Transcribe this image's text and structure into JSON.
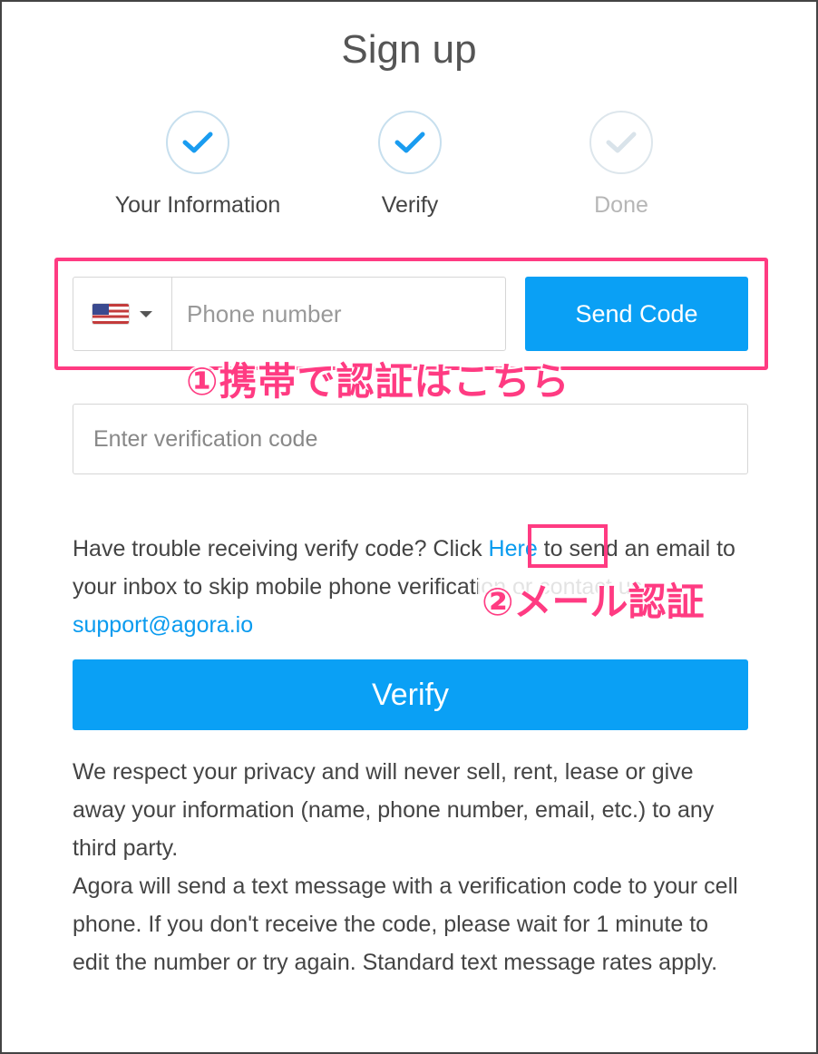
{
  "page": {
    "title": "Sign up"
  },
  "steps": [
    {
      "label": "Your Information",
      "state": "complete",
      "icon": "check-icon"
    },
    {
      "label": "Verify",
      "state": "complete",
      "icon": "check-icon"
    },
    {
      "label": "Done",
      "state": "pending",
      "icon": "check-icon"
    }
  ],
  "phone": {
    "country_icon": "us-flag-icon",
    "placeholder": "Phone number",
    "send_label": "Send Code"
  },
  "code": {
    "placeholder": "Enter verification code"
  },
  "trouble": {
    "text_before": "Have trouble receiving verify code? Click ",
    "here_label": "Here",
    "text_after": " to send an email to your inbox to skip mobile phone verification or contact us ",
    "support_email": "support@agora.io"
  },
  "verify_button": {
    "label": "Verify"
  },
  "privacy": {
    "paragraph1": "We respect your privacy and will never sell, rent, lease or give away your information (name, phone number, email, etc.) to any third party.",
    "paragraph2": "Agora will send a text message with a verification code to your cell phone. If you don't receive the code, please wait for 1 minute to edit the number or try again. Standard text message rates apply."
  },
  "annotations": {
    "mobile_auth": "①携帯で認証はこちら",
    "email_auth": "②メール認証"
  },
  "colors": {
    "accent": "#0aa0f5",
    "check_active": "#1a9cf0",
    "check_inactive": "#d9e3ea",
    "annotation": "#ff3b82"
  }
}
